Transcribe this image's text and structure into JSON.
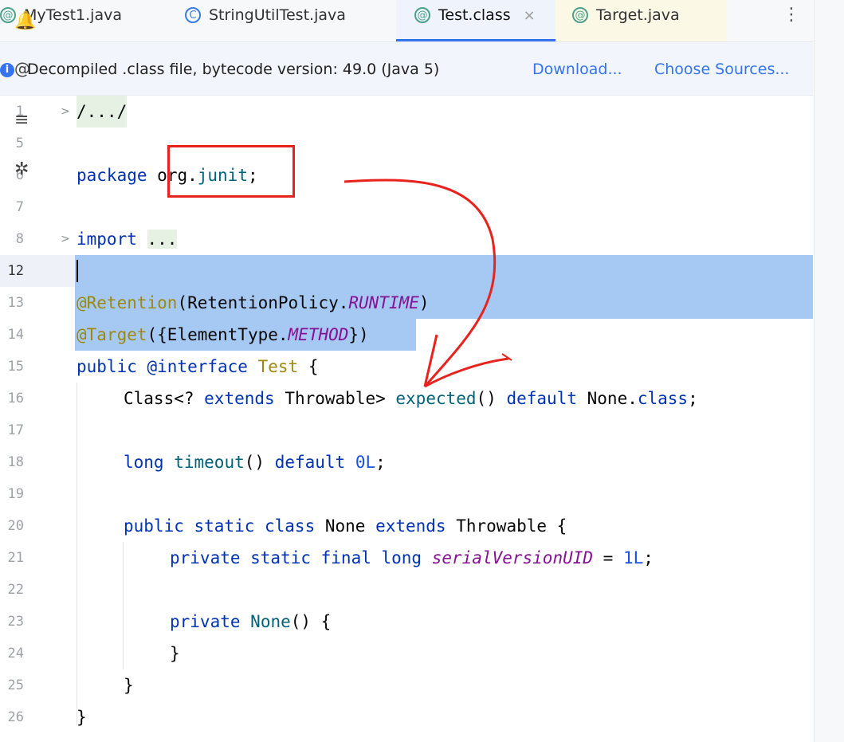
{
  "tabs": [
    {
      "label": "MyTest1.java",
      "icon": "annotation-icon"
    },
    {
      "label": "StringUtilTest.java",
      "icon": "class-test-icon"
    },
    {
      "label": "Test.class",
      "icon": "annotation-icon",
      "active": true
    },
    {
      "label": "Target.java",
      "icon": "annotation-icon"
    }
  ],
  "tab_close": "×",
  "more_menu": "⋮",
  "banner": {
    "text": "Decompiled .class file, bytecode version: 49.0 (Java 5)",
    "download": "Download...",
    "choose_sources": "Choose Sources..."
  },
  "line_numbers": [
    "1",
    "5",
    "6",
    "7",
    "8",
    "12",
    "13",
    "14",
    "15",
    "16",
    "17",
    "18",
    "19",
    "20",
    "21",
    "22",
    "23",
    "24",
    "25",
    "26"
  ],
  "code": {
    "l1": "/.../",
    "l6_kw": "package",
    "l6_pkg1": "org.",
    "l6_pkg2": "junit",
    "l6_semi": ";",
    "l8_kw": "import",
    "l8_fold": "...",
    "l13_ann": "@Retention",
    "l13_mid": "(RetentionPolicy.",
    "l13_const": "RUNTIME",
    "l13_end": ")",
    "l14_ann": "@Target",
    "l14_mid": "({ElementType.",
    "l14_const": "METHOD",
    "l14_end": "})",
    "l15_kw": "public @interface",
    "l15_name": "Test",
    "l15_brace": "{",
    "l16_a": "Class<? ",
    "l16_kw1": "extends",
    "l16_b": " Throwable> ",
    "l16_fn": "expected",
    "l16_c": "() ",
    "l16_kw2": "default",
    "l16_d": " None.",
    "l16_kw3": "class",
    "l16_e": ";",
    "l18_kw": "long",
    "l18_fn": "timeout",
    "l18_b": "() ",
    "l18_kw2": "default",
    "l18_num": "0L",
    "l18_e": ";",
    "l20_kw": "public static class",
    "l20_b": " None ",
    "l20_kw2": "extends",
    "l20_c": " Throwable {",
    "l21_kw": "private static final long",
    "l21_field": "serialVersionUID",
    "l21_eq": " = ",
    "l21_num": "1L",
    "l21_e": ";",
    "l23_kw": "private",
    "l23_fn": "None",
    "l23_b": "() {",
    "l24": "}",
    "l25": "}",
    "l26": "}"
  },
  "colors": {
    "selection": "#a6c9f4",
    "annotation_box": "#e8231e",
    "accent": "#3574f0"
  }
}
